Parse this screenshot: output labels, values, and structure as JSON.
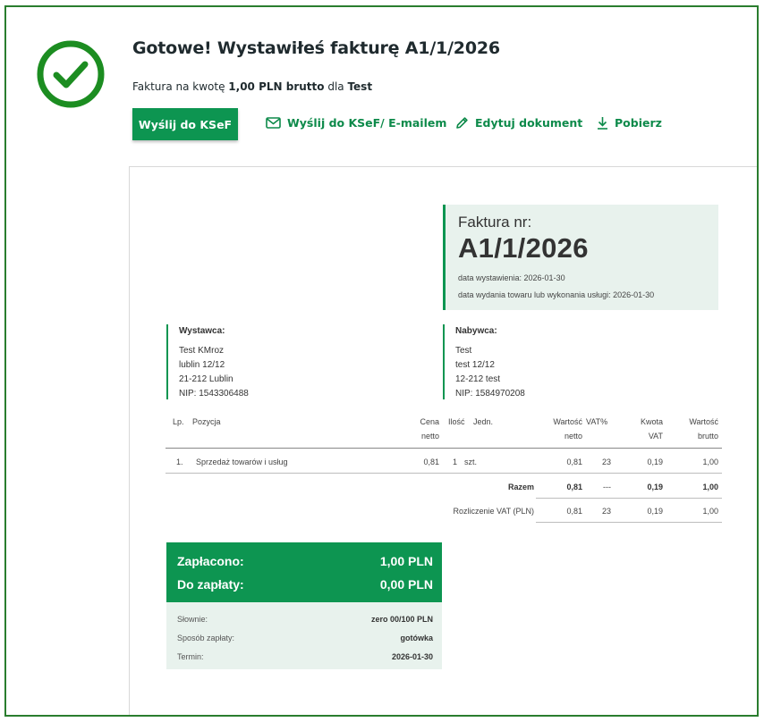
{
  "header": {
    "title": "Gotowe! Wystawiłeś fakturę A1/1/2026",
    "subtitle_prefix": "Faktura na kwotę ",
    "subtitle_amount": "1,00 PLN brutto",
    "subtitle_mid": " dla ",
    "subtitle_client": "Test"
  },
  "actions": {
    "send_ksef": "Wyślij do KSeF",
    "send_ksef_email": "Wyślij do KSeF/ E-mailem",
    "edit": "Edytuj dokument",
    "download": "Pobierz"
  },
  "invoice": {
    "label": "Faktura nr:",
    "number": "A1/1/2026",
    "issue_date": "data wystawienia: 2026-01-30",
    "delivery_date": "data wydania towaru lub wykonania usługi: 2026-01-30",
    "seller": {
      "heading": "Wystawca:",
      "name": "Test KMroz",
      "street": "lublin 12/12",
      "city": "21-212 Lublin",
      "nip": "NIP: 1543306488"
    },
    "buyer": {
      "heading": "Nabywca:",
      "name": "Test",
      "street": "test 12/12",
      "city": "12-212 test",
      "nip": "NIP: 1584970208"
    },
    "columns": {
      "lp": "Lp.",
      "item": "Pozycja",
      "net_price_1": "Cena",
      "net_price_2": "netto",
      "qty": "Ilość",
      "unit": "Jedn.",
      "net_value_1": "Wartość",
      "net_value_2": "netto",
      "vat_rate": "VAT%",
      "vat_amount_1": "Kwota",
      "vat_amount_2": "VAT",
      "gross_value_1": "Wartość",
      "gross_value_2": "brutto"
    },
    "rows": [
      {
        "lp": "1.",
        "item": "Sprzedaż towarów i usług",
        "net_price": "0,81",
        "qty": "1",
        "unit": "szt.",
        "net_value": "0,81",
        "vat_rate": "23",
        "vat_amount": "0,19",
        "gross_value": "1,00"
      }
    ],
    "total": {
      "label": "Razem",
      "net_value": "0,81",
      "vat_rate": "---",
      "vat_amount": "0,19",
      "gross_value": "1,00"
    },
    "vat_summary": {
      "label": "Rozliczenie VAT (PLN)",
      "net_value": "0,81",
      "vat_rate": "23",
      "vat_amount": "0,19",
      "gross_value": "1,00"
    },
    "payment": {
      "paid_label": "Zapłacono:",
      "paid_value": "1,00 PLN",
      "due_label": "Do zapłaty:",
      "due_value": "0,00 PLN",
      "words_label": "Słownie:",
      "words_value": "zero 00/100 PLN",
      "method_label": "Sposób zapłaty:",
      "method_value": "gotówka",
      "term_label": "Termin:",
      "term_value": "2026-01-30"
    }
  },
  "colors": {
    "brand_green": "#0d9551",
    "frame_green": "#2a7d2e",
    "light_green": "#e8f2ed"
  },
  "icons": {
    "success": "check-circle-icon",
    "email": "envelope-icon",
    "edit": "pencil-icon",
    "download": "download-arrow-icon"
  }
}
